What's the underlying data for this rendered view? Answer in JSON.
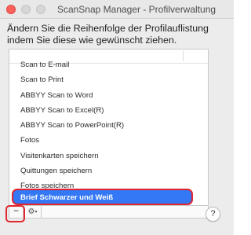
{
  "window": {
    "title": "ScanSnap Manager - Profilverwaltung"
  },
  "instruction": "Ändern Sie die Reihenfolge der Profilauflistung indem Sie diese wie gewünscht ziehen.",
  "profile_list": {
    "items": [
      "Scan to E-mail",
      "Scan to Print",
      "ABBYY Scan to Word",
      "ABBYY Scan to Excel(R)",
      "ABBYY Scan to PowerPoint(R)",
      "Fotos",
      "Visitenkarten speichern",
      "Quittungen speichern",
      "Fotos speichern"
    ],
    "selected": "Brief Schwarzer und Weiß"
  },
  "buttons": {
    "remove": "−",
    "gear": "⚙",
    "gear_chevron": "▾",
    "help": "?"
  },
  "colors": {
    "selection": "#3478f6",
    "highlight_outline": "#e0262e",
    "close_button": "#fc605b"
  }
}
